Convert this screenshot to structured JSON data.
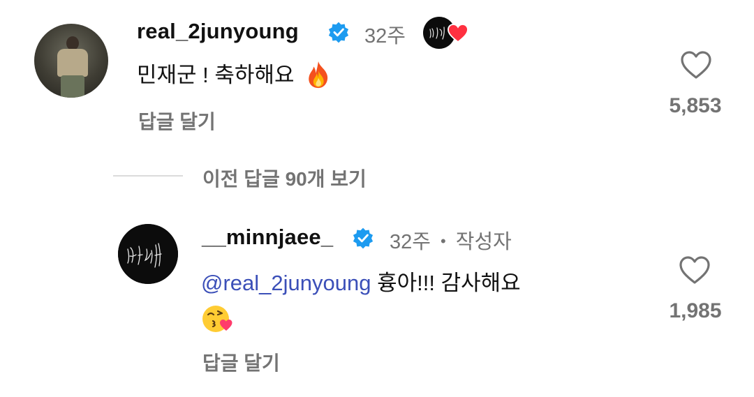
{
  "comment1": {
    "username": "real_2junyoung",
    "time": "32주",
    "text": "민재군 ! 축하해요",
    "emoji": "fire-emoji",
    "reply_label": "답글 달기",
    "likes": "5,853",
    "liked_by_author": true
  },
  "thread": {
    "view_replies_label": "이전 답글 90개 보기"
  },
  "comment2": {
    "username": "__minnjaee_",
    "time": "32주",
    "separator": "•",
    "author_badge": "작성자",
    "mention": "@real_2junyoung",
    "text": "흉아!!! 감사해요",
    "emoji": "kissing-heart-emoji",
    "reply_label": "답글 달기",
    "likes": "1,985"
  },
  "colors": {
    "verified": "#1d9bf0",
    "heart_red": "#ff3040",
    "mention": "#3b4fb8",
    "secondary_text": "#737373"
  }
}
